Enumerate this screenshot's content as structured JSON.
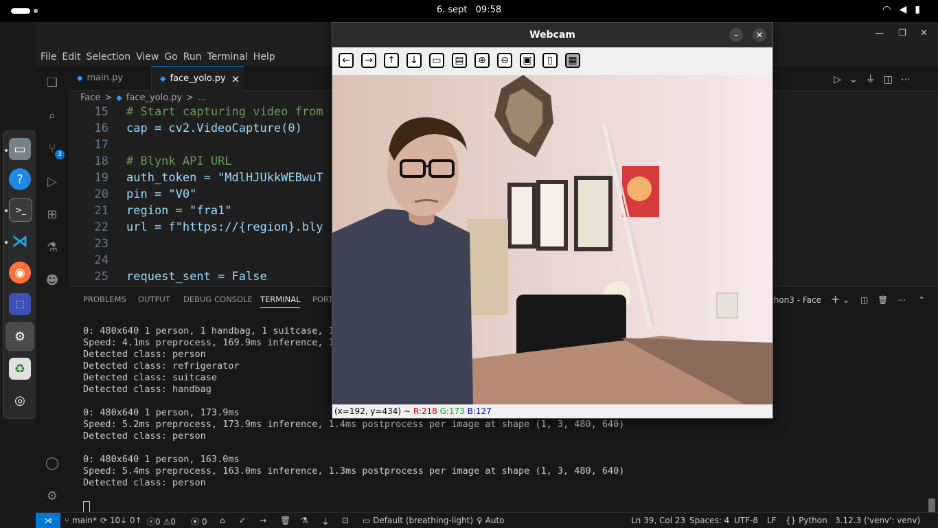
{
  "topbar": {
    "date": "6. sept",
    "time": "09:58",
    "system_icons": "wifi-icon volume-icon battery-icon"
  },
  "vscode": {
    "menu": [
      "File",
      "Edit",
      "Selection",
      "View",
      "Go",
      "Run",
      "Terminal",
      "Help"
    ],
    "tabs": [
      {
        "label": "main.py",
        "active": false
      },
      {
        "label": "face_yolo.py",
        "active": true,
        "close": "×"
      }
    ],
    "breadcrumb": [
      "Face",
      ">",
      "face_yolo.py",
      ">",
      "..."
    ],
    "source_control_badge": "3",
    "code_lines": [
      {
        "n": "15",
        "text": "# Start capturing video from"
      },
      {
        "n": "16",
        "text": "cap = cv2.VideoCapture(0)"
      },
      {
        "n": "17",
        "text": ""
      },
      {
        "n": "18",
        "text": "# Blynk API URL"
      },
      {
        "n": "19",
        "text": "auth_token = \"MdlHJUkkWEBwuT"
      },
      {
        "n": "20",
        "text": "pin = \"V0\""
      },
      {
        "n": "21",
        "text": "region = \"fra1\""
      },
      {
        "n": "22",
        "text": "url = f\"https://{region}.bly"
      },
      {
        "n": "23",
        "text": ""
      },
      {
        "n": "24",
        "text": ""
      },
      {
        "n": "25",
        "text": "request_sent = False"
      }
    ],
    "panel_tabs": [
      "PROBLEMS",
      "OUTPUT",
      "DEBUG CONSOLE",
      "TERMINAL",
      "PORT"
    ],
    "panel_active": "TERMINAL",
    "terminal_name": "thon3 - Face",
    "terminal_lines": [
      "0: 480x640 1 person, 1 handbag, 1 suitcase, 1",
      "Speed: 4.1ms preprocess, 169.9ms inference, 1",
      "Detected class: person",
      "Detected class: refrigerator",
      "Detected class: suitcase",
      "Detected class: handbag",
      "",
      "0: 480x640 1 person, 173.9ms",
      "Speed: 5.2ms preprocess, 173.9ms inference, 1.4ms postprocess per image at shape (1, 3, 480, 640)",
      "Detected class: person",
      "",
      "0: 480x640 1 person, 163.0ms",
      "Speed: 5.4ms preprocess, 163.0ms inference, 1.3ms postprocess per image at shape (1, 3, 480, 640)",
      "Detected class: person"
    ],
    "status": {
      "branch": "main*",
      "sync": "10↓ 0↑",
      "errors": "0",
      "warnings": "0",
      "ports": "0",
      "profile": "Default (breathing-light)",
      "auto": "Auto",
      "position": "Ln 39, Col 23",
      "spaces": "Spaces: 4",
      "encoding": "UTF-8",
      "eol": "LF",
      "language": "Python",
      "interpreter": "3.12.3 ('venv': venv)"
    }
  },
  "webcam": {
    "title": "Webcam",
    "toolbar": [
      "arrow-left-icon",
      "arrow-right-icon",
      "arrow-up-icon",
      "arrow-down-icon",
      "image-icon",
      "image-settings-icon",
      "zoom-in-icon",
      "zoom-out-icon",
      "save-icon",
      "clipboard-icon",
      "properties-icon"
    ],
    "status_coords": "(x=192, y=434) ~",
    "status_r": "R:218",
    "status_g": "G:173",
    "status_b": "B:127",
    "status_colors": {
      "r": "#d00000",
      "g": "#00b000",
      "b": "#0000d0"
    }
  }
}
